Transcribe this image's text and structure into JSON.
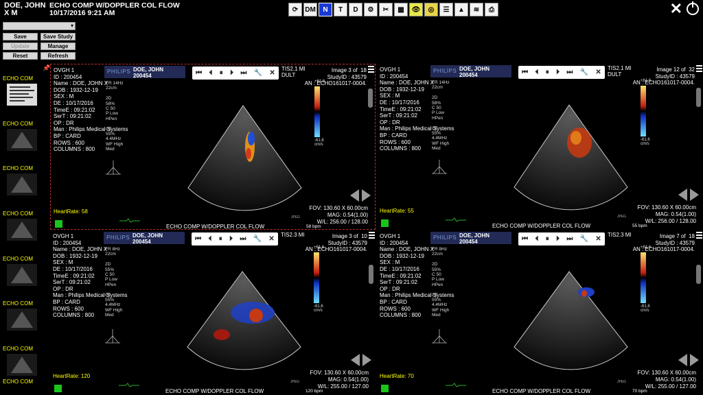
{
  "header": {
    "patient_name": "DOE, JOHN X M",
    "study_title": "ECHO COMP W/DOPPLER COL FLOW",
    "study_datetime": "10/17/2016 9:21 AM"
  },
  "toolbar": [
    {
      "name": "refresh-icon",
      "label": "⟳"
    },
    {
      "name": "dm-button",
      "label": "DM"
    },
    {
      "name": "n-button",
      "label": "N",
      "active": true
    },
    {
      "name": "t-button",
      "label": "T"
    },
    {
      "name": "d-button",
      "label": "D"
    },
    {
      "name": "settings-icon",
      "label": "⚙"
    },
    {
      "name": "tools-icon",
      "label": "✂"
    },
    {
      "name": "grid-icon",
      "label": "▦"
    },
    {
      "name": "eye-icon",
      "label": "👁"
    },
    {
      "name": "film-icon",
      "label": "◎"
    },
    {
      "name": "sliders-icon",
      "label": "☰"
    },
    {
      "name": "image-icon",
      "label": "▲"
    },
    {
      "name": "layers-icon",
      "label": "≋"
    },
    {
      "name": "print-icon",
      "label": "⎙"
    }
  ],
  "left_controls": {
    "select_value": "",
    "save": "Save",
    "save_study": "Save Study",
    "update": "Update",
    "manage": "Manage",
    "reset": "Reset",
    "refresh": "Refresh"
  },
  "thumbnails": [
    {
      "label": "ECHO COM"
    },
    {
      "label": "ECHO COM"
    },
    {
      "label": "ECHO COM"
    },
    {
      "label": "ECHO COM"
    },
    {
      "label": "ECHO COM"
    },
    {
      "label": "ECHO COM"
    },
    {
      "label": "ECHO COM"
    },
    {
      "label": "ECHO COM"
    }
  ],
  "viewports": [
    {
      "info": "OVGH 1\nID : 200454\nName : DOE, JOHN X\nDOB : 1932-12-19\nSEX : M\nDE : 10/17/2016\nTimeE : 09:21:02\nSerT : 09:21:02\nOP : DR\nMan : Philips Medical Systems\nBP : CARD\nROWS : 600\nCOLUMNS : 800",
      "brand": "PHILIPS",
      "name": "DOE, JOHN\n200454",
      "tis": "TIS2.1  MI",
      "tis2": "DULT",
      "image": "Image 3 of  18\nStudyID : 43579\nAN : ECHO161017-0004.",
      "params": "FR 14Hz\n22cm\n\n2D\n58%\nC 50\nP Low\nHPen\n\nCF\n55%\n4.4MHz\nWF High\nMed",
      "cbar_top": "+61.6",
      "cbar_bottom": "-61.6\ncm/s",
      "heart_rate": "HeartRate: 58",
      "measure": "FOV: 130.60 X 60.00cm\nMAG: 0.54(1.00)\nW/L: 256.00 / 128.00",
      "caption": "ECHO COMP W/DOPPLER   COL FLOW",
      "bpm": "58 bpm",
      "jpeg": "JPEG"
    },
    {
      "info": "OVGH 1\nID : 200454\nName : DOE, JOHN X\nDOB : 1932-12-19\nSEX : M\nDE : 10/17/2016\nTimeE : 09:21:02\nSerT : 09:21:02\nOP : DR\nMan : Philips Medical Systems\nBP : CARD\nROWS : 600\nCOLUMNS : 800",
      "brand": "PHILIPS",
      "name": "DOE, JOHN\n200454",
      "tis": "TIS2.1  MI",
      "tis2": "DULT",
      "image": "Image 12 of  32\nStudyID : 43579\nAN : ECHO161017-0004.",
      "params": "FR 14Hz\n22cm\n\n2D\n58%\nC 50\nP Low\nHPen\n\nCF\n55%\n4.4MHz\nWF High\nMed",
      "cbar_top": "+61.6",
      "cbar_bottom": "-61.6\ncm/s",
      "heart_rate": "HeartRate: 55",
      "measure": "FOV: 130.60 X 60.00cm\nMAG: 0.54(1.00)\nW/L: 256.00 / 128.00",
      "caption": "ECHO COMP W/DOPPLER   COL FLOW",
      "bpm": "55 bpm",
      "jpeg": "JPEG"
    },
    {
      "info": "OVGH 1\nID : 200454\nName : DOE, JOHN X\nDOB : 1932-12-19\nSEX : M\nDE : 10/17/2016\nTimeE : 09:21:02\nSerT : 09:21:02\nOP : DR\nMan : Philips Medical Systems\nBP : CARD\nROWS : 600\nCOLUMNS : 800",
      "brand": "PHILIPS",
      "name": "DOE, JOHN\n200454",
      "tis": "TIS2.3  MI",
      "tis2": "",
      "image": "Image 3 of  10\nStudyID : 43579\nAN : ECHO161017-0004.",
      "params": "FR 8Hz\n22cm\n\n2D\n55%\nC 50\nP Low\nHPen\n\nCF\n55%\n4.4MHz\nWF High\nMed",
      "cbar_top": "+61.6",
      "cbar_bottom": "-61.6\ncm/s",
      "heart_rate": "HeartRate: 120",
      "measure": "FOV: 130.60 X 60.00cm\nMAG: 0.54(1.00)\nW/L: 255.00 / 127.00",
      "caption": "ECHO COMP W/DOPPLER   COL FLOW",
      "bpm": "120 bpm",
      "jpeg": "JPEG"
    },
    {
      "info": "OVGH 1\nID : 200454\nName : DOE, JOHN X\nDOB : 1932-12-19\nSEX : M\nDE : 10/17/2016\nTimeE : 09:21:02\nSerT : 09:21:02\nOP : DR\nMan : Philips Medical Systems\nBP : CARD\nROWS : 600\nCOLUMNS : 800",
      "brand": "PHILIPS",
      "name": "DOE, JOHN\n200454",
      "tis": "TIS2.3  MI",
      "tis2": "",
      "image": "Image 7 of  18\nStudyID : 43579\nAN : ECHO161017-0004.",
      "params": "FR 8Hz\n22cm\n\n2D\n55%\nC 50\nP Low\nHPen\n\nCF\n55%\n4.4MHz\nWF High\nMed",
      "cbar_top": "+61.6",
      "cbar_bottom": "-61.6\ncm/s",
      "heart_rate": "HeartRate: 70",
      "measure": "FOV: 130.60 X 60.00cm\nMAG: 0.54(1.00)\nW/L: 255.00 / 127.00",
      "caption": "ECHO COMP W/DOPPLER   COL FLOW",
      "bpm": "70 bpm",
      "jpeg": "JPEG"
    }
  ],
  "player_controls": [
    "skip-first-icon",
    "step-back-icon",
    "pause-icon",
    "step-forward-icon",
    "skip-last-icon",
    "wrench-icon",
    "close-icon"
  ],
  "colors": {
    "accent_active": "#1a3ad6",
    "heart_rate": "#ffff00",
    "active_border": "#c03030",
    "thumb_label": "#ffff00"
  }
}
